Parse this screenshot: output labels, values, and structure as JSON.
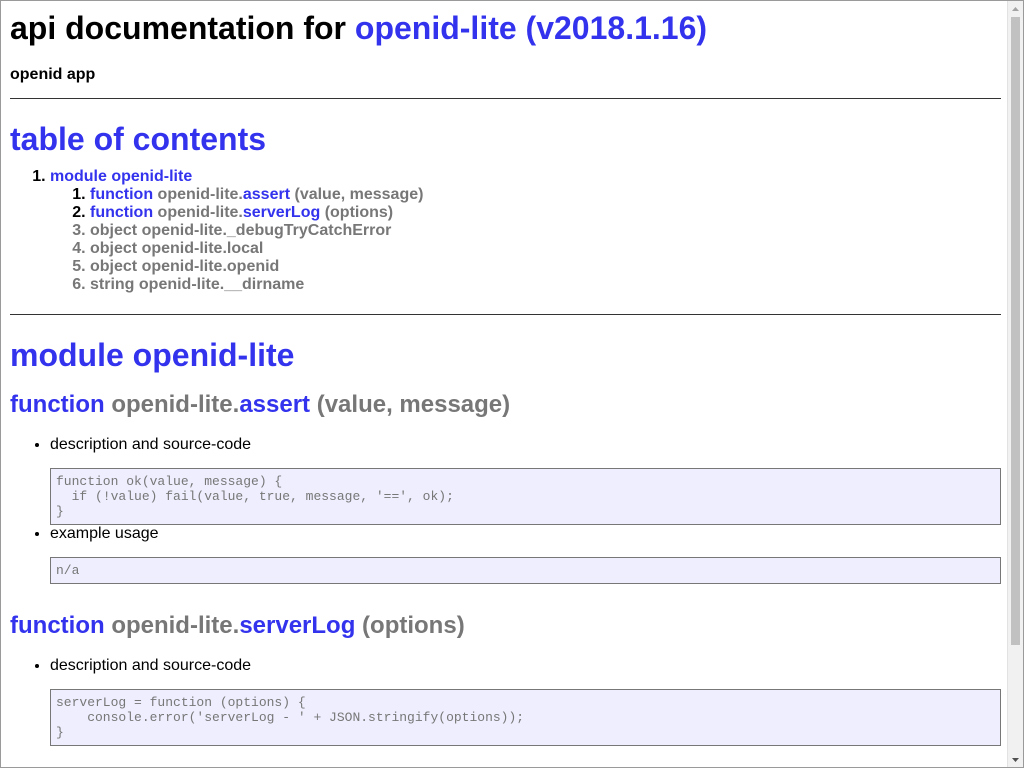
{
  "header": {
    "title_prefix": "api documentation for",
    "title_link": "openid-lite (v2018.1.16)",
    "subtitle": "openid app"
  },
  "toc": {
    "title": "table of contents",
    "module_label": "module openid-lite",
    "items": [
      {
        "kind": "function",
        "prefix": "openid-lite.",
        "name": "assert",
        "args": "(value, message)"
      },
      {
        "kind": "function",
        "prefix": "openid-lite.",
        "name": "serverLog",
        "args": "(options)"
      },
      {
        "text": "object openid-lite._debugTryCatchError"
      },
      {
        "text": "object openid-lite.local"
      },
      {
        "text": "object openid-lite.openid"
      },
      {
        "text": "string openid-lite.__dirname"
      }
    ]
  },
  "module": {
    "title": "module openid-lite",
    "functions": [
      {
        "kind": "function",
        "prefix": "openid-lite.",
        "name": "assert",
        "args": "(value, message)",
        "desc_label": "description and source-code",
        "source": "function ok(value, message) {\n  if (!value) fail(value, true, message, '==', ok);\n}",
        "usage_label": "example usage",
        "usage": "n/a"
      },
      {
        "kind": "function",
        "prefix": "openid-lite.",
        "name": "serverLog",
        "args": "(options)",
        "desc_label": "description and source-code",
        "source": "serverLog = function (options) {\n    console.error('serverLog - ' + JSON.stringify(options));\n}"
      }
    ]
  }
}
